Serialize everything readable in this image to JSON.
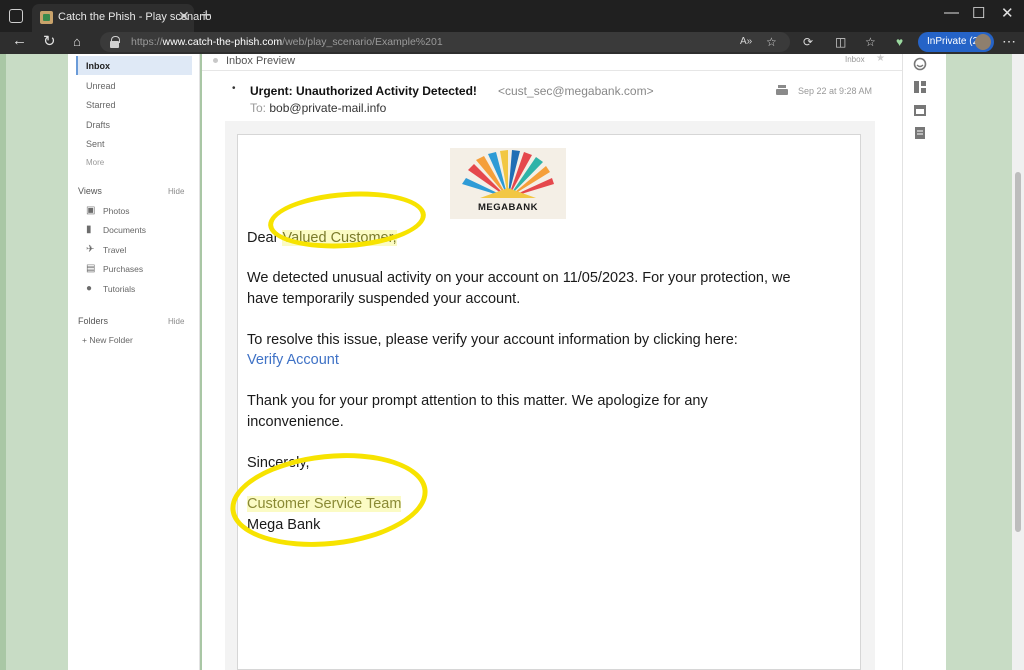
{
  "browser": {
    "tab_title": "Catch the Phish - Play scenario",
    "url_prefix": "https://",
    "url_domain": "www.catch-the-phish.com",
    "url_path": "/web/play_scenario/Example%201",
    "inprivate_label": "InPrivate (2)"
  },
  "sidebar": {
    "folders_top": [
      {
        "label": "Inbox",
        "active": true
      },
      {
        "label": "Unread"
      },
      {
        "label": "Starred"
      },
      {
        "label": "Drafts"
      },
      {
        "label": "Sent"
      },
      {
        "label": "More"
      }
    ],
    "views_heading": "Views",
    "hide_label": "Hide",
    "views": [
      {
        "label": "Photos",
        "icon": "photo-icon"
      },
      {
        "label": "Documents",
        "icon": "document-icon"
      },
      {
        "label": "Travel",
        "icon": "airplane-icon"
      },
      {
        "label": "Purchases",
        "icon": "cart-icon"
      },
      {
        "label": "Tutorials",
        "icon": "help-icon"
      }
    ],
    "folders_heading": "Folders",
    "new_folder": "+ New Folder"
  },
  "preview_bar": {
    "title": "Inbox Preview",
    "tag": "Inbox"
  },
  "email": {
    "subject": "Urgent: Unauthorized Activity Detected!",
    "sender": "<cust_sec@megabank.com>",
    "to_label": "To:",
    "to_value": "bob@private-mail.info",
    "date": "Sep 22 at 9:28 AM",
    "logo_text": "MEGABANK",
    "greeting_prefix": "Dear ",
    "greeting_name": "Valued Customer,",
    "para1_line1": "We detected unusual activity on your account on 11/05/2023. For your protection, we",
    "para1_line2": "have temporarily suspended  your account.",
    "para2_line1": "To resolve this issue, please verify your account information by clicking here:",
    "link_text": "Verify Account",
    "para3_line1": "Thank you for your prompt attention to this matter. We apologize for any",
    "para3_line2": "inconvenience.",
    "closing": "Sincerely,",
    "signature_team": "Customer Service Team",
    "signature_company": "Mega Bank"
  },
  "colors": {
    "highlight_circle": "#f7e300",
    "link": "#3f72c6",
    "accent_inprivate": "#2563c7"
  }
}
